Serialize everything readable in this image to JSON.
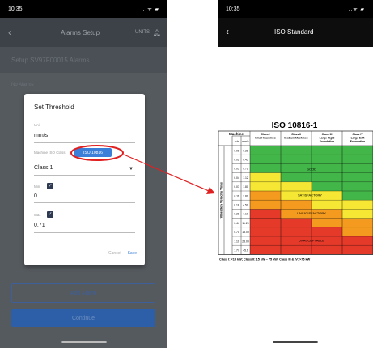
{
  "left_screen": {
    "status_time": "10:35",
    "status_icons": "..ᯤ ▰",
    "header": {
      "title": "Alarms Setup",
      "units_label": "UNITS"
    },
    "setup_bar": "Setup SV97F00015 Alarms",
    "faint_text": "No Alarms",
    "dialog": {
      "title": "Set Threshold",
      "unit_label": "Unit",
      "unit_value": "mm/s",
      "machine_label": "Machine ISO Class",
      "iso_chip": "ISO 10816",
      "class_value": "Class 1",
      "min_label": "Min",
      "min_value": "0",
      "max_label": "Max",
      "max_value": "0.71",
      "cancel": "Cancel",
      "save": "Save"
    },
    "add_alarm": "Add Alarm",
    "continue": "Continue"
  },
  "right_screen": {
    "status_time": "10:35",
    "status_icons": "..ᯤ ▰",
    "header": {
      "title": "ISO Standard"
    },
    "iso_table": {
      "title": "ISO 10816-1",
      "machine_header": "Machine",
      "vertical_label": "Vibration Velocity Vrms",
      "units": [
        "in/s",
        "mm/s"
      ],
      "class_headers": [
        "Class I Small Machines",
        "Class II Medium Machines",
        "Class III Large Rigid Foundation",
        "Class IV Large Soft Foundation"
      ],
      "rows": [
        [
          "0.01",
          "0.28"
        ],
        [
          "0.02",
          "0.45"
        ],
        [
          "0.03",
          "0.71"
        ],
        [
          "0.04",
          "1.12"
        ],
        [
          "0.07",
          "1.80"
        ],
        [
          "0.11",
          "2.80"
        ],
        [
          "0.18",
          "4.50"
        ],
        [
          "0.28",
          "7.10"
        ],
        [
          "0.44",
          "11.20"
        ],
        [
          "0.70",
          "18.00"
        ],
        [
          "1.10",
          "28.00"
        ],
        [
          "1.77",
          "45.9"
        ]
      ],
      "zones": {
        "good": "GOOD",
        "satisfactory": "SATISFACTORY",
        "unsatisfactory": "UNSATISFACTORY",
        "unacceptable": "UNACCEPTABLE"
      },
      "footer": "Class I: <15 kW; Class II: 15 kW ~ 75 kW; Class III & IV: >75 kW",
      "colors": {
        "good": "#43b649",
        "satisfactory": "#f5e733",
        "unsatisfactory": "#f39a1f",
        "unacceptable": "#e53a2a"
      }
    }
  },
  "annotation": {
    "color": "#e02020"
  }
}
